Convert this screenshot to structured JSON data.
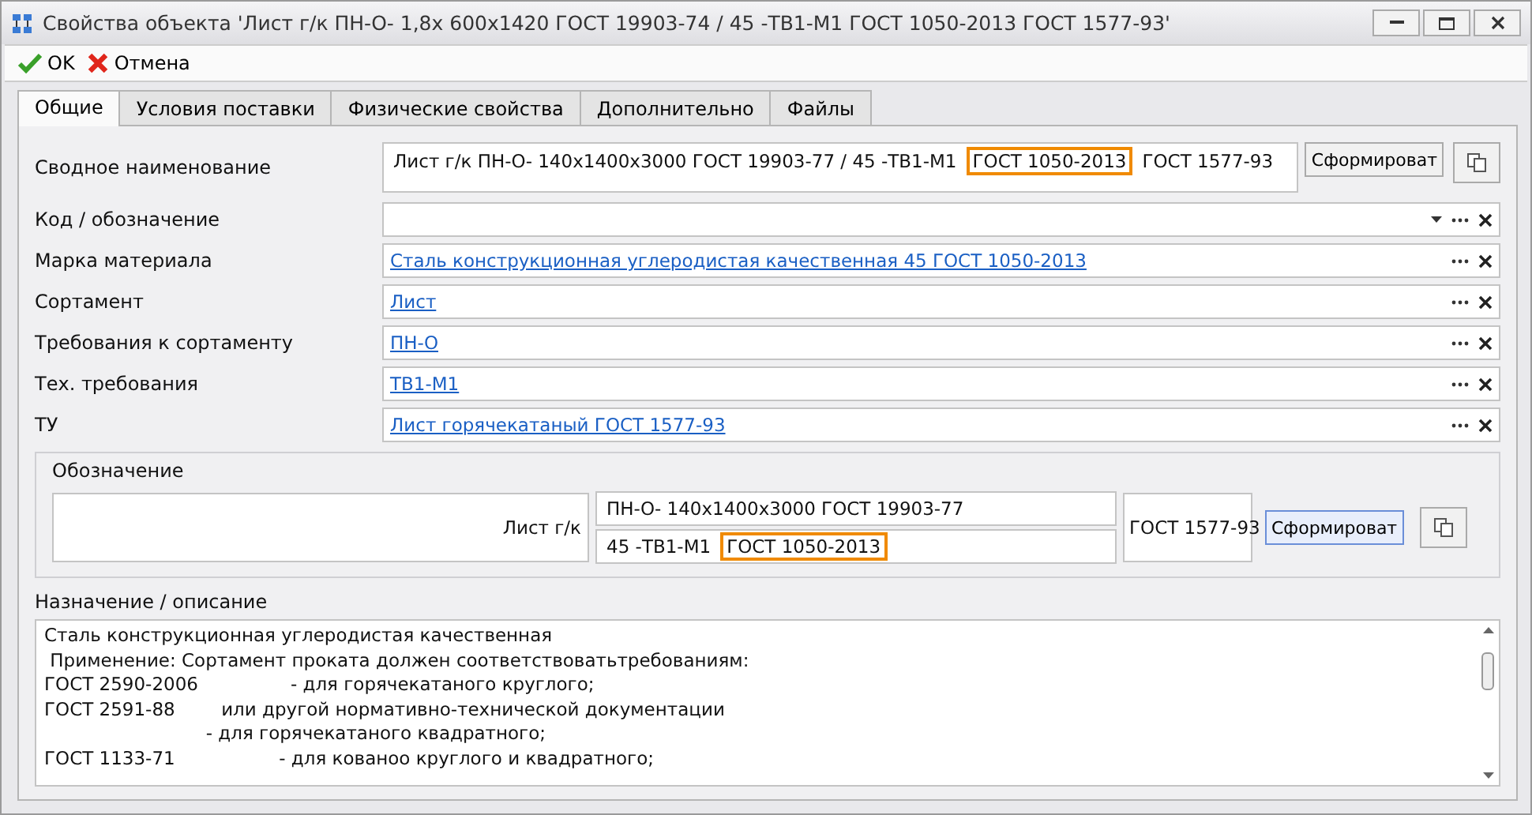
{
  "window": {
    "title": "Свойства объекта 'Лист г/к ПН-О- 1,8х 600х1420 ГОСТ 19903-74 / 45 -ТВ1-М1 ГОСТ 1050-2013 ГОСТ 1577-93'"
  },
  "toolbar": [
    {
      "kind": "ok",
      "label": "OK"
    },
    {
      "kind": "cancel",
      "label": "Отмена"
    }
  ],
  "tabs": [
    {
      "label": "Общие",
      "selected": true
    },
    {
      "label": "Условия поставки",
      "selected": false
    },
    {
      "label": "Физические свойства",
      "selected": false
    },
    {
      "label": "Дополнительно",
      "selected": false
    },
    {
      "label": "Файлы",
      "selected": false
    }
  ],
  "summary": {
    "label": "Сводное наименование",
    "value": [
      {
        "text": "Лист г/к ПН-О- 140х1400х3000 ГОСТ 19903-77 / 45 -ТВ1-М1",
        "highlighted": false
      },
      {
        "text": "ГОСТ 1050-2013",
        "highlighted": true
      },
      {
        "text": "ГОСТ 1577-93",
        "highlighted": false
      }
    ],
    "button": "Сформироват"
  },
  "fields": [
    {
      "label": "Код / обозначение",
      "kind": "combo"
    },
    {
      "label": "Марка материала",
      "kind": "link",
      "value": "Сталь конструкционная углеродистая качественная 45 ГОСТ 1050-2013"
    },
    {
      "label": "Сортамент",
      "kind": "link",
      "value": "Лист"
    },
    {
      "label": "Требования к сортаменту",
      "kind": "link",
      "value": "ПН-О"
    },
    {
      "label": "Тех. требования",
      "kind": "link",
      "value": "ТВ1-М1"
    },
    {
      "label": "ТУ",
      "kind": "link",
      "value": "Лист горячекатаный ГОСТ 1577-93"
    }
  ],
  "designation": {
    "label": "Обозначение",
    "name": "Лист г/к",
    "line_1": [
      {
        "text": "ПН-О- 140х1400х3000 ГОСТ 19903-77",
        "highlighted": false
      }
    ],
    "line_2": [
      {
        "text": "45 -ТВ1-М1",
        "highlighted": false
      },
      {
        "text": "ГОСТ 1050-2013",
        "highlighted": true
      }
    ],
    "standard": "ГОСТ 1577-93",
    "button": "Сформироват"
  },
  "description": {
    "label": "Назначение / описание",
    "lines": [
      "Сталь конструкционная углеродистая качественная",
      " Применение: Сортамент проката должен соответствоватьтребованиям:",
      "ГОСТ 2590-2006                - для горячекатаного круглого;",
      "ГОСТ 2591-88        или другой нормативно-технической документации",
      "                            - для горячекатаного квадратного;",
      "ГОСТ 1133-71                  - для кованоо круглого и квадратного;"
    ]
  }
}
